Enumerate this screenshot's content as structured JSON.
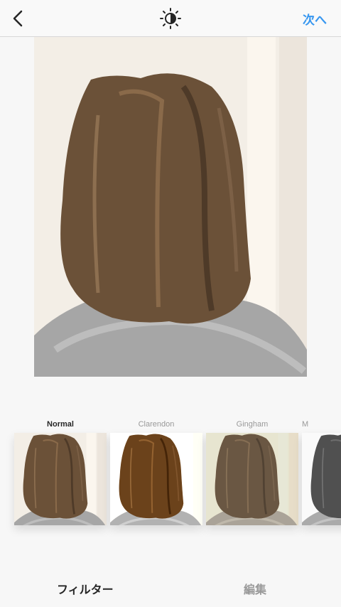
{
  "header": {
    "back_icon": "chevron-left-icon",
    "adjust_icon": "lux-sun-icon",
    "next_label": "次へ",
    "accent_color": "#3897f0"
  },
  "filters": [
    {
      "name": "Normal",
      "selected": true
    },
    {
      "name": "Clarendon",
      "selected": false
    },
    {
      "name": "Gingham",
      "selected": false
    },
    {
      "name": "M",
      "selected": false
    }
  ],
  "tabs": {
    "filter": "フィルター",
    "edit": "編集"
  }
}
